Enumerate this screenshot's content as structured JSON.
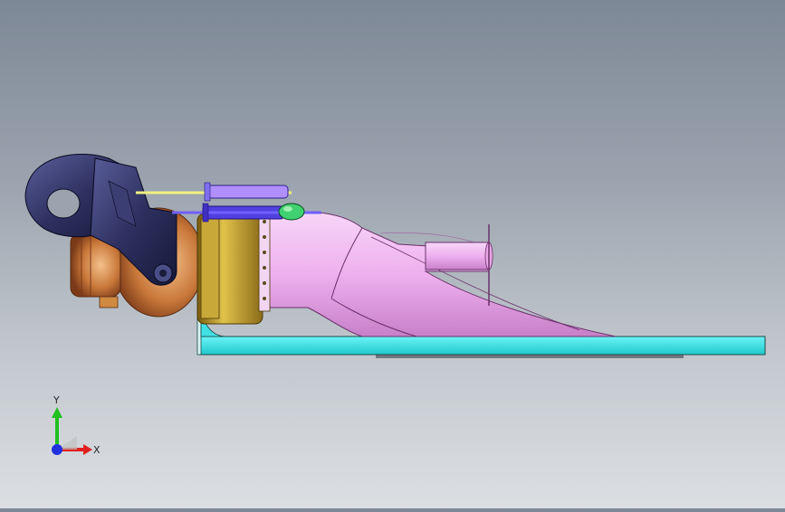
{
  "viewport": {
    "name": "cad-graphics-area",
    "background_top": "#7d8896",
    "background_bottom": "#dcdfe2"
  },
  "model": {
    "parts": [
      {
        "name": "intake-nozzle",
        "color": "#2e3160"
      },
      {
        "name": "pump-housing",
        "color": "#c97a3a"
      },
      {
        "name": "flange-ring",
        "color": "#b89a2a"
      },
      {
        "name": "duct-tube",
        "color": "#f0b8f0"
      },
      {
        "name": "base-plate",
        "color": "#33e6ea"
      },
      {
        "name": "actuator-rod",
        "color": "#7060ff"
      },
      {
        "name": "sensor-bulb",
        "color": "#3fd070"
      }
    ]
  },
  "triad": {
    "x_label": "X",
    "y_label": "Y",
    "x_color": "#e02020",
    "y_color": "#20c020",
    "z_color": "#2030e0"
  }
}
